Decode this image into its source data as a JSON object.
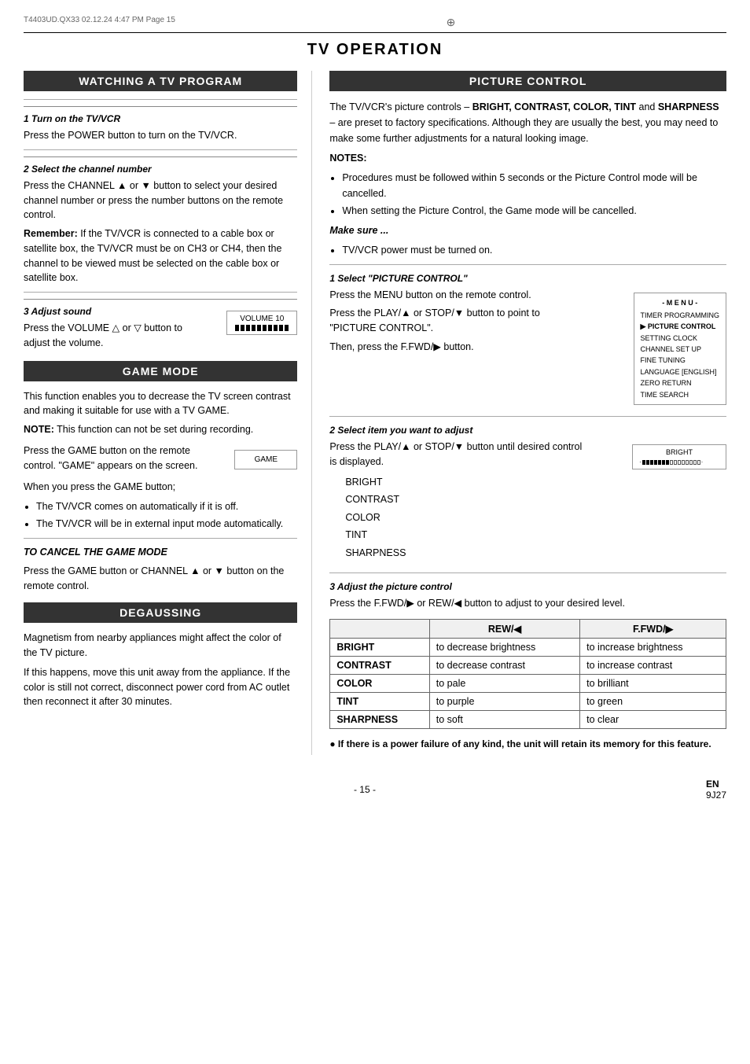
{
  "header": {
    "file_info": "T4403UD.QX33  02.12.24  4:47 PM  Page 15"
  },
  "main_title": "TV OPERATION",
  "left_column": {
    "section1": {
      "title": "WATCHING A TV PROGRAM",
      "steps": [
        {
          "number": "1  Turn on the TV/VCR",
          "body": "Press the POWER button to turn on the TV/VCR."
        },
        {
          "number": "2  Select the channel number",
          "body": "Press the CHANNEL ▲ or ▼ button to select your desired channel number or press the number buttons on the remote control.",
          "remember": "Remember: If the TV/VCR is connected to a cable box or satellite box, the TV/VCR must be on CH3 or CH4, then the channel to be viewed must be selected on the cable box or satellite box."
        },
        {
          "number": "3  Adjust sound",
          "body": "Press the VOLUME △ or ▽ button to adjust the volume.",
          "volume_label": "VOLUME  10"
        }
      ]
    },
    "section2": {
      "title": "GAME MODE",
      "intro": "This function enables you to decrease the TV screen contrast and making it suitable for use with a TV GAME.",
      "note": "NOTE: This function can not be set during recording.",
      "game_button_label": "GAME",
      "game_desc": "Press the GAME button on the remote control. \"GAME\" appears on the screen.",
      "when_press": "When you press the GAME button;",
      "bullets": [
        "The TV/VCR comes on automatically if it is off.",
        "The TV/VCR will be in external input mode automatically."
      ],
      "cancel_title": "TO CANCEL THE GAME MODE",
      "cancel_body": "Press the GAME button or CHANNEL ▲ or ▼ button on the remote control."
    },
    "section3": {
      "title": "DEGAUSSING",
      "body1": "Magnetism from nearby appliances might affect the color of the TV picture.",
      "body2": "If this happens, move this unit away from the appliance. If the color is still not correct, disconnect power cord from AC outlet then reconnect it after 30 minutes."
    }
  },
  "right_column": {
    "section1": {
      "title": "PICTURE CONTROL",
      "intro_bold": "BRIGHT, CONTRAST, COLOR, TINT",
      "intro_rest": " and ",
      "intro_sharpness": "SHARPNESS",
      "intro_after": " – are preset to factory specifications. Although they are usually the best, you may need to make some further adjustments for a natural looking image.",
      "intro_prefix": "The TV/VCR's picture controls – ",
      "notes_header": "NOTES:",
      "notes": [
        "Procedures must be followed within 5 seconds or the Picture Control mode will be cancelled.",
        "When setting the Picture Control, the Game mode will be cancelled."
      ],
      "make_sure": "Make sure ...",
      "make_sure_bullet": "TV/VCR power must be turned on.",
      "step1": {
        "number": "1  Select \"PICTURE CONTROL\"",
        "body1": "Press the MENU button on the remote control.",
        "body2": "Press the PLAY/▲ or STOP/▼ button to point to \"PICTURE CONTROL\".",
        "body3": "Then, press the F.FWD/▶ button.",
        "menu_title": "- M E N U -",
        "menu_items": [
          "TIMER PROGRAMMING",
          "▶ PICTURE CONTROL",
          "SETTING CLOCK",
          "CHANNEL SET UP",
          "FINE TUNING",
          "LANGUAGE [ENGLISH]",
          "ZERO RETURN",
          "TIME SEARCH"
        ]
      },
      "step2": {
        "number": "2  Select item you want to adjust",
        "body": "Press the PLAY/▲ or STOP/▼ button until desired control is displayed.",
        "items": [
          "BRIGHT",
          "CONTRAST",
          "COLOR",
          "TINT",
          "SHARPNESS"
        ],
        "display_label": "BRIGHT",
        "bar_filled": 7,
        "bar_empty": 8
      },
      "step3": {
        "number": "3  Adjust the picture control",
        "body": "Press the F.FWD/▶ or REW/◀ button to adjust to your desired level.",
        "table": {
          "headers": [
            "",
            "REW/◀",
            "F.FWD/▶"
          ],
          "rows": [
            {
              "label": "BRIGHT",
              "rew": "to decrease brightness",
              "ffwd": "to increase brightness"
            },
            {
              "label": "CONTRAST",
              "rew": "to decrease contrast",
              "ffwd": "to increase contrast"
            },
            {
              "label": "COLOR",
              "rew": "to pale",
              "ffwd": "to brilliant"
            },
            {
              "label": "TINT",
              "rew": "to purple",
              "ffwd": "to green"
            },
            {
              "label": "SHARPNESS",
              "rew": "to soft",
              "ffwd": "to clear"
            }
          ]
        },
        "bottom_note": "If there is a power failure of any kind, the unit will retain its memory for this feature."
      }
    }
  },
  "footer": {
    "page_num": "- 15 -",
    "lang": "EN",
    "code": "9J27"
  }
}
